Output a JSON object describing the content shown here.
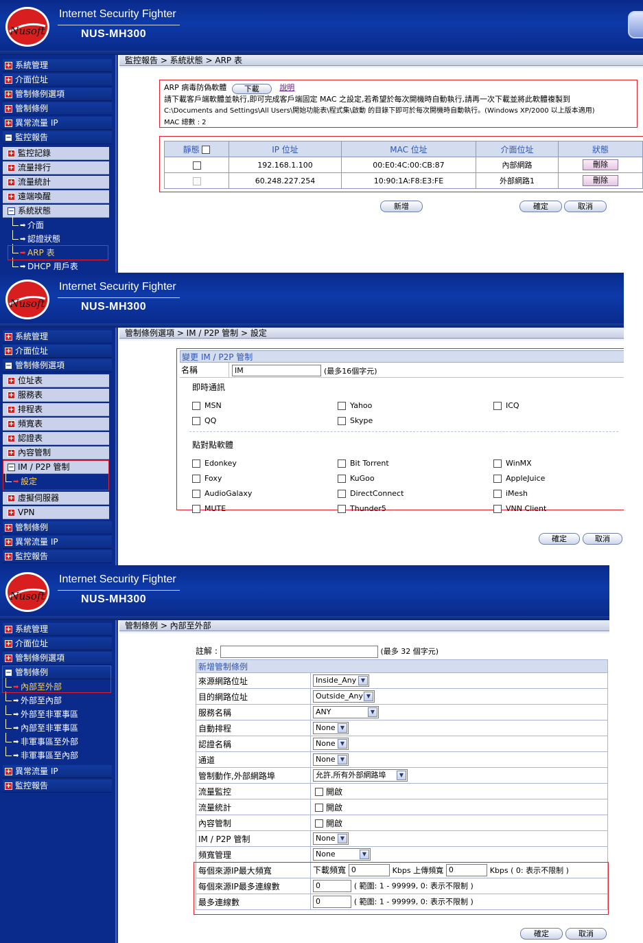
{
  "brand": {
    "logo_text": "Nusoft",
    "title": "Internet Security Fighter",
    "model": "NUS-MH300"
  },
  "colors": {
    "header_blue": "#0a2a8c",
    "highlight_red": "#e0202a",
    "table_header": "#d4dcef",
    "table_header_text": "#2d56b6",
    "active_item": "#ffd24a"
  },
  "panel1": {
    "sidebar": {
      "items": [
        {
          "label": "系統管理",
          "icon": "plus-icon"
        },
        {
          "label": "介面位址",
          "icon": "plus-icon"
        },
        {
          "label": "管制條例選項",
          "icon": "plus-icon"
        },
        {
          "label": "管制條例",
          "icon": "plus-icon"
        },
        {
          "label": "異常流量 IP",
          "icon": "plus-icon"
        },
        {
          "label": "監控報告",
          "icon": "minus-icon"
        }
      ],
      "subitems": [
        {
          "label": "監控記錄"
        },
        {
          "label": "流量排行"
        },
        {
          "label": "流量統計"
        },
        {
          "label": "遠端喚醒"
        },
        {
          "label": "系統狀態"
        }
      ],
      "leaves": [
        {
          "label": "介面"
        },
        {
          "label": "認證狀態"
        },
        {
          "label": "ARP 表"
        },
        {
          "label": "DHCP 用戶表"
        }
      ]
    },
    "breadcrumb": "監控報告 > 系統狀態 > ARP 表",
    "info": {
      "label": "ARP 病毒防偽軟體",
      "download_button": "下載",
      "help_link": "說明",
      "line1": "請下載客戶端軟體並執行,即可完成客戶端固定 MAC 之設定,若希望於每次開機時自動執行,請再一次下載並將此軟體複製到",
      "line2": "C:\\Documents and Settings\\All Users\\開始功能表\\程式集\\啟動 的目錄下即可於每次開機時自動執行。(Windows XP/2000 以上版本適用)",
      "mac_total": "MAC 總數 : 2"
    },
    "table": {
      "headers": [
        "靜態",
        "IP 位址",
        "MAC 位址",
        "介面位址",
        "狀態"
      ],
      "rows": [
        {
          "ip": "192.168.1.100",
          "mac": "00:E0:4C:00:CB:87",
          "iface": "內部網路",
          "action": "刪除"
        },
        {
          "ip": "60.248.227.254",
          "mac": "10:90:1A:F8:E3:FE",
          "iface": "外部網路1",
          "action": "刪除"
        }
      ]
    },
    "buttons": {
      "add": "新增",
      "ok": "確定",
      "cancel": "取消"
    }
  },
  "panel2": {
    "sidebar": {
      "items_top": [
        {
          "label": "系統管理"
        },
        {
          "label": "介面位址"
        },
        {
          "label": "管制條例選項"
        }
      ],
      "subitems": [
        {
          "label": "位址表"
        },
        {
          "label": "服務表"
        },
        {
          "label": "排程表"
        },
        {
          "label": "頻寬表"
        },
        {
          "label": "認證表"
        },
        {
          "label": "內容管制"
        },
        {
          "label": "IM / P2P 管制"
        },
        {
          "label": "虛擬伺服器"
        },
        {
          "label": "VPN"
        }
      ],
      "leaf": "設定",
      "items_bottom": [
        {
          "label": "管制條例"
        },
        {
          "label": "異常流量 IP"
        },
        {
          "label": "監控報告"
        }
      ]
    },
    "breadcrumb": "管制條例選項 > IM / P2P 管制 > 設定",
    "form": {
      "title": "變更 IM / P2P 管制",
      "name_label": "名稱",
      "name_value": "IM",
      "name_hint": "(最多16個字元)",
      "im_group": "即時通訊",
      "im_options": [
        "MSN",
        "Yahoo",
        "ICQ",
        "QQ",
        "Skype"
      ],
      "p2p_group": "點對點軟體",
      "p2p_options": [
        "Edonkey",
        "Bit Torrent",
        "WinMX",
        "Foxy",
        "KuGoo",
        "AppleJuice",
        "AudioGalaxy",
        "DirectConnect",
        "iMesh",
        "MUTE",
        "Thunder5",
        "VNN Client"
      ]
    },
    "buttons": {
      "ok": "確定",
      "cancel": "取消"
    }
  },
  "panel3": {
    "sidebar": {
      "items_top": [
        {
          "label": "系統管理"
        },
        {
          "label": "介面位址"
        },
        {
          "label": "管制條例選項"
        },
        {
          "label": "管制條例"
        }
      ],
      "leaves": [
        {
          "label": "內部至外部"
        },
        {
          "label": "外部至內部"
        },
        {
          "label": "外部至非軍事區"
        },
        {
          "label": "內部至非軍事區"
        },
        {
          "label": "非軍事區至外部"
        },
        {
          "label": "非軍事區至內部"
        }
      ],
      "items_bottom": [
        {
          "label": "異常流量 IP"
        },
        {
          "label": "監控報告"
        }
      ]
    },
    "breadcrumb": "管制條例 > 內部至外部",
    "note_label": "註解 :",
    "note_hint": "(最多 32 個字元)",
    "table_title": "新增管制條例",
    "rows": {
      "src": {
        "label": "來源網路位址",
        "value": "Inside_Any"
      },
      "dst": {
        "label": "目的網路位址",
        "value": "Outside_Any"
      },
      "svc": {
        "label": "服務名稱",
        "value": "ANY"
      },
      "sched": {
        "label": "自動排程",
        "value": "None"
      },
      "auth": {
        "label": "認證名稱",
        "value": "None"
      },
      "tunnel": {
        "label": "通道",
        "value": "None"
      },
      "action": {
        "label": "管制動作,外部網路埠",
        "value": "允許,所有外部網路埠"
      },
      "monitor": {
        "label": "流量監控",
        "value": "開啟"
      },
      "stats": {
        "label": "流量統計",
        "value": "開啟"
      },
      "content": {
        "label": "內容管制",
        "value": "開啟"
      },
      "im": {
        "label": "IM / P2P 管制",
        "value": "None"
      },
      "bw": {
        "label": "頻寬管理",
        "value": "None"
      },
      "maxbw": {
        "label": "每個來源IP最大頻寬",
        "down_label": "下載頻寬",
        "down_value": "0",
        "kbps_up": "Kbps 上傳頻寬",
        "up_value": "0",
        "kbps_hint": "Kbps ( 0: 表示不限制 )"
      },
      "maxconn_ip": {
        "label": "每個來源IP最多連線數",
        "value": "0",
        "hint": "( 範圍: 1 - 99999, 0: 表示不限制 )"
      },
      "maxconn": {
        "label": "最多連線數",
        "value": "0",
        "hint": "( 範圍: 1 - 99999, 0: 表示不限制 )"
      }
    },
    "buttons": {
      "ok": "確定",
      "cancel": "取消"
    }
  }
}
